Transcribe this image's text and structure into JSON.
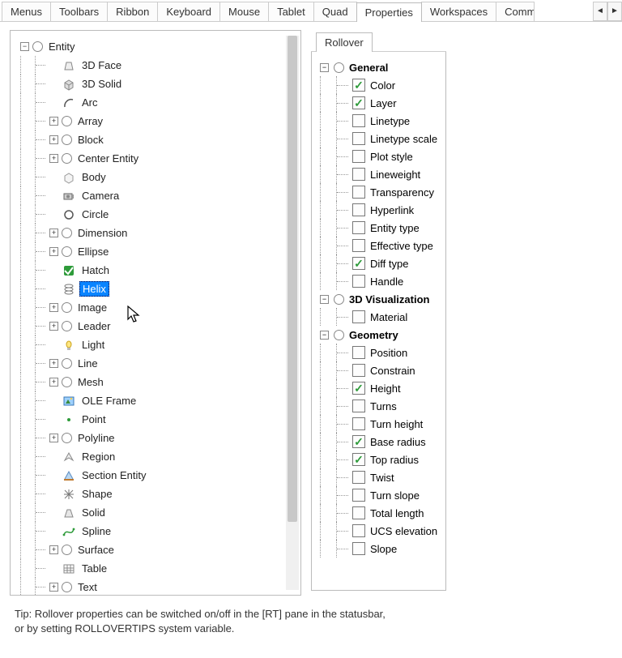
{
  "tabs": {
    "items": [
      "Menus",
      "Toolbars",
      "Ribbon",
      "Keyboard",
      "Mouse",
      "Tablet",
      "Quad",
      "Properties",
      "Workspaces",
      "Comm"
    ],
    "active": "Properties"
  },
  "subtabs": {
    "items": [
      "Rollover"
    ],
    "active": "Rollover"
  },
  "left_tree": {
    "root": {
      "label": "Entity",
      "toggle": "−",
      "bullet": true
    },
    "children": [
      {
        "label": "3D Face",
        "icon": "face3d",
        "expand": ""
      },
      {
        "label": "3D Solid",
        "icon": "solid3d",
        "expand": ""
      },
      {
        "label": "Arc",
        "icon": "arc",
        "expand": ""
      },
      {
        "label": "Array",
        "bullet": true,
        "expand": "+"
      },
      {
        "label": "Block",
        "bullet": true,
        "expand": "+"
      },
      {
        "label": "Center Entity",
        "bullet": true,
        "expand": "+"
      },
      {
        "label": "Body",
        "icon": "body",
        "expand": ""
      },
      {
        "label": "Camera",
        "icon": "camera",
        "expand": ""
      },
      {
        "label": "Circle",
        "icon": "circle",
        "expand": ""
      },
      {
        "label": "Dimension",
        "bullet": true,
        "expand": "+"
      },
      {
        "label": "Ellipse",
        "bullet": true,
        "expand": "+"
      },
      {
        "label": "Hatch",
        "icon": "hatch",
        "expand": ""
      },
      {
        "label": "Helix",
        "icon": "helix",
        "expand": "",
        "selected": true
      },
      {
        "label": "Image",
        "bullet": true,
        "expand": "+"
      },
      {
        "label": "Leader",
        "bullet": true,
        "expand": "+"
      },
      {
        "label": "Light",
        "icon": "light",
        "expand": ""
      },
      {
        "label": "Line",
        "bullet": true,
        "expand": "+"
      },
      {
        "label": "Mesh",
        "bullet": true,
        "expand": "+"
      },
      {
        "label": "OLE Frame",
        "icon": "ole",
        "expand": ""
      },
      {
        "label": "Point",
        "icon": "point",
        "expand": ""
      },
      {
        "label": "Polyline",
        "bullet": true,
        "expand": "+"
      },
      {
        "label": "Region",
        "icon": "region",
        "expand": ""
      },
      {
        "label": "Section Entity",
        "icon": "section",
        "expand": ""
      },
      {
        "label": "Shape",
        "icon": "shape",
        "expand": ""
      },
      {
        "label": "Solid",
        "icon": "solid",
        "expand": ""
      },
      {
        "label": "Spline",
        "icon": "spline",
        "expand": ""
      },
      {
        "label": "Surface",
        "bullet": true,
        "expand": "+"
      },
      {
        "label": "Table",
        "icon": "table",
        "expand": ""
      },
      {
        "label": "Text",
        "bullet": true,
        "expand": "+"
      }
    ]
  },
  "right_tree": [
    {
      "header": "General",
      "toggle": "−",
      "items": [
        {
          "label": "Color",
          "checked": true
        },
        {
          "label": "Layer",
          "checked": true
        },
        {
          "label": "Linetype",
          "checked": false
        },
        {
          "label": "Linetype scale",
          "checked": false
        },
        {
          "label": "Plot style",
          "checked": false
        },
        {
          "label": "Lineweight",
          "checked": false
        },
        {
          "label": "Transparency",
          "checked": false
        },
        {
          "label": "Hyperlink",
          "checked": false
        },
        {
          "label": "Entity type",
          "checked": false
        },
        {
          "label": "Effective type",
          "checked": false
        },
        {
          "label": "Diff type",
          "checked": true
        },
        {
          "label": "Handle",
          "checked": false
        }
      ]
    },
    {
      "header": "3D Visualization",
      "toggle": "−",
      "items": [
        {
          "label": "Material",
          "checked": false
        }
      ]
    },
    {
      "header": "Geometry",
      "toggle": "−",
      "items": [
        {
          "label": "Position",
          "checked": false
        },
        {
          "label": "Constrain",
          "checked": false
        },
        {
          "label": "Height",
          "checked": true
        },
        {
          "label": "Turns",
          "checked": false
        },
        {
          "label": "Turn height",
          "checked": false
        },
        {
          "label": "Base radius",
          "checked": true
        },
        {
          "label": "Top radius",
          "checked": true
        },
        {
          "label": "Twist",
          "checked": false
        },
        {
          "label": "Turn slope",
          "checked": false
        },
        {
          "label": "Total length",
          "checked": false
        },
        {
          "label": "UCS elevation",
          "checked": false
        },
        {
          "label": "Slope",
          "checked": false
        }
      ]
    }
  ],
  "tip": {
    "line1": "Tip: Rollover properties can be switched on/off in the [RT] pane in the statusbar,",
    "line2": "or by setting ROLLOVERTIPS system variable."
  },
  "nav": {
    "left": "◄",
    "right": "►"
  }
}
